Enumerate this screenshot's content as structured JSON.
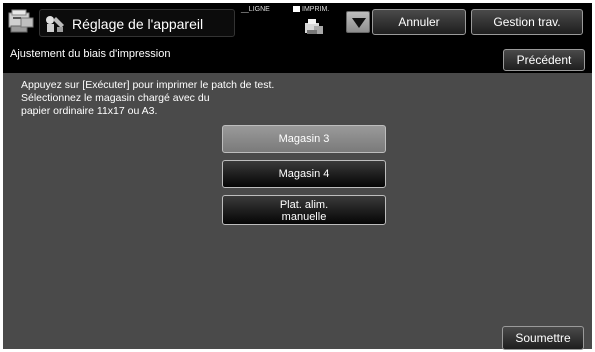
{
  "header": {
    "title": "Réglage de l'appareil",
    "status_ligne": "LIGNE",
    "status_imprim": "IMPRIM.",
    "cancel_label": "Annuler",
    "job_management_label": "Gestion trav."
  },
  "subheader": {
    "title": "Ajustement du biais d'impression",
    "previous_label": "Précédent"
  },
  "instructions": [
    "Appuyez sur [Exécuter] pour imprimer le patch de test.",
    "Sélectionnez le magasin chargé avec du",
    "papier ordinaire 11x17 ou A3."
  ],
  "trays": {
    "tray3": "Magasin 3",
    "tray4": "Magasin 4",
    "manual_line1": "Plat. alim.",
    "manual_line2": "manuelle",
    "selected": "Magasin 3"
  },
  "submit_label": "Soumettre",
  "icons": {
    "home": "copier-home-icon",
    "title": "machine-settings-icon",
    "printer": "printer-status-icon",
    "dropdown": "triangle-down-icon"
  },
  "colors": {
    "background": "#4a4a4a",
    "header": "#000000",
    "selected_button": "#8a8a8a",
    "button": "#111111"
  }
}
